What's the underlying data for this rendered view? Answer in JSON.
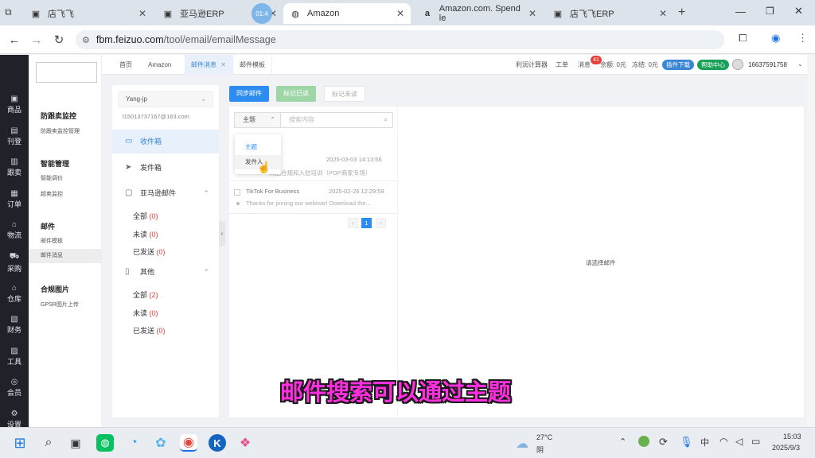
{
  "browser": {
    "tabs": [
      {
        "label": "店飞飞",
        "icon": "image-icon"
      },
      {
        "label": "亚马逊ERP",
        "icon": "image-icon"
      },
      {
        "label": "Amazon",
        "icon": "globe-icon",
        "active": true
      },
      {
        "label": "Amazon.com. Spend le",
        "icon": "amazon-icon"
      },
      {
        "label": "店飞飞ERP",
        "icon": "image-icon"
      }
    ],
    "timer_badge": "01:4",
    "url_domain": "fbm.feizuo.com",
    "url_path": "/tool/email/emailMessage"
  },
  "leftbar": [
    "商品",
    "刊登",
    "跟卖",
    "订单",
    "物流",
    "采购",
    "仓库",
    "财务",
    "工具",
    "会员",
    "设置"
  ],
  "menu": {
    "groups": [
      {
        "title": "防跟卖监控",
        "items": [
          "防跟卖监控管理"
        ]
      },
      {
        "title": "智能管理",
        "items": [
          "智能调价",
          "超卖监控"
        ]
      },
      {
        "title": "邮件",
        "items": [
          "邮件模板",
          "邮件消息"
        ]
      },
      {
        "title": "合规图片",
        "items": [
          "GPSR图片上传"
        ]
      }
    ]
  },
  "topnav": {
    "tabs": [
      "首页",
      "Amazon",
      "邮件消息",
      "邮件模板"
    ],
    "profit_calc": "利润计算器",
    "ticket": "工单",
    "messages": "消息",
    "msg_count": "41",
    "balance": "余额: 0元",
    "frozen": "冻结: 0元",
    "plugin_download": "插件下载",
    "help_center": "帮助中心",
    "phone": "16637591758"
  },
  "mailnav": {
    "account": "Yang-jp",
    "email": "l15013737167@163.com",
    "inbox": "收件箱",
    "sent": "发件箱",
    "amazon_mail": "亚马逊邮件",
    "amazon_all": "全部",
    "amazon_all_count": "(0)",
    "amazon_unread": "未读",
    "amazon_unread_count": "(0)",
    "amazon_sent": "已发送",
    "amazon_sent_count": "(0)",
    "other": "其他",
    "other_all": "全部",
    "other_all_count": "(2)",
    "other_unread": "未读",
    "other_unread_count": "(0)",
    "other_sent": "已发送",
    "other_sent_count": "(0)"
  },
  "toolbar": {
    "sync": "同步邮件",
    "mark_read": "标记已读",
    "mark_unread": "标记未读",
    "search_field": "主题",
    "search_placeholder": "搜索内容",
    "dropdown_options": [
      "主题",
      "发件人"
    ]
  },
  "messages": [
    {
      "sender": "",
      "date": "2025-03-03 14:13:56",
      "preview": "商品合规和入驻培训（POP商家专场）"
    },
    {
      "sender": "TikTok For Business",
      "date": "2025-02-26 12:29:59",
      "preview": "Thanks for joining our webinar! Download the..."
    }
  ],
  "pagination": {
    "current": "1"
  },
  "detail_placeholder": "请选择邮件",
  "subtitle": "邮件搜索可以通过主题",
  "taskbar": {
    "temp": "27°C",
    "weather": "阴",
    "ime": "中",
    "time": "15:03",
    "date": "2025/9/3"
  }
}
